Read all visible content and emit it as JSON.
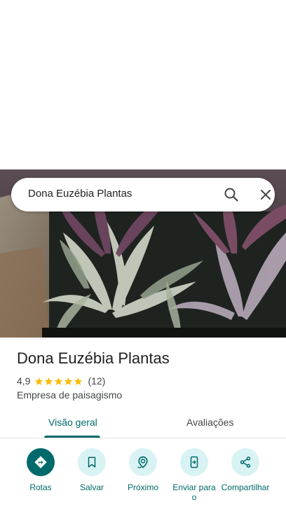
{
  "search": {
    "query": "Dona Euzébia Plantas",
    "search_icon": "search-icon",
    "close_icon": "close-icon"
  },
  "hero": {
    "image_subject": "potted dracaena plants"
  },
  "place": {
    "name": "Dona Euzébia Plantas",
    "rating": "4,9",
    "stars": 5,
    "review_count": "(12)",
    "category": "Empresa de paisagismo",
    "star_color": "#fbbc04"
  },
  "tabs": [
    {
      "label": "Visão geral",
      "active": true
    },
    {
      "label": "Avaliações",
      "active": false
    }
  ],
  "actions": [
    {
      "label": "Rotas",
      "icon": "directions-icon"
    },
    {
      "label": "Salvar",
      "icon": "bookmark-icon"
    },
    {
      "label": "Próximo",
      "icon": "nearby-icon"
    },
    {
      "label": "Enviar para o",
      "icon": "send-to-phone-icon"
    },
    {
      "label": "Compartilhar",
      "icon": "share-icon"
    }
  ],
  "colors": {
    "accent": "#00696b",
    "action_bg": "#d9f3f5"
  }
}
